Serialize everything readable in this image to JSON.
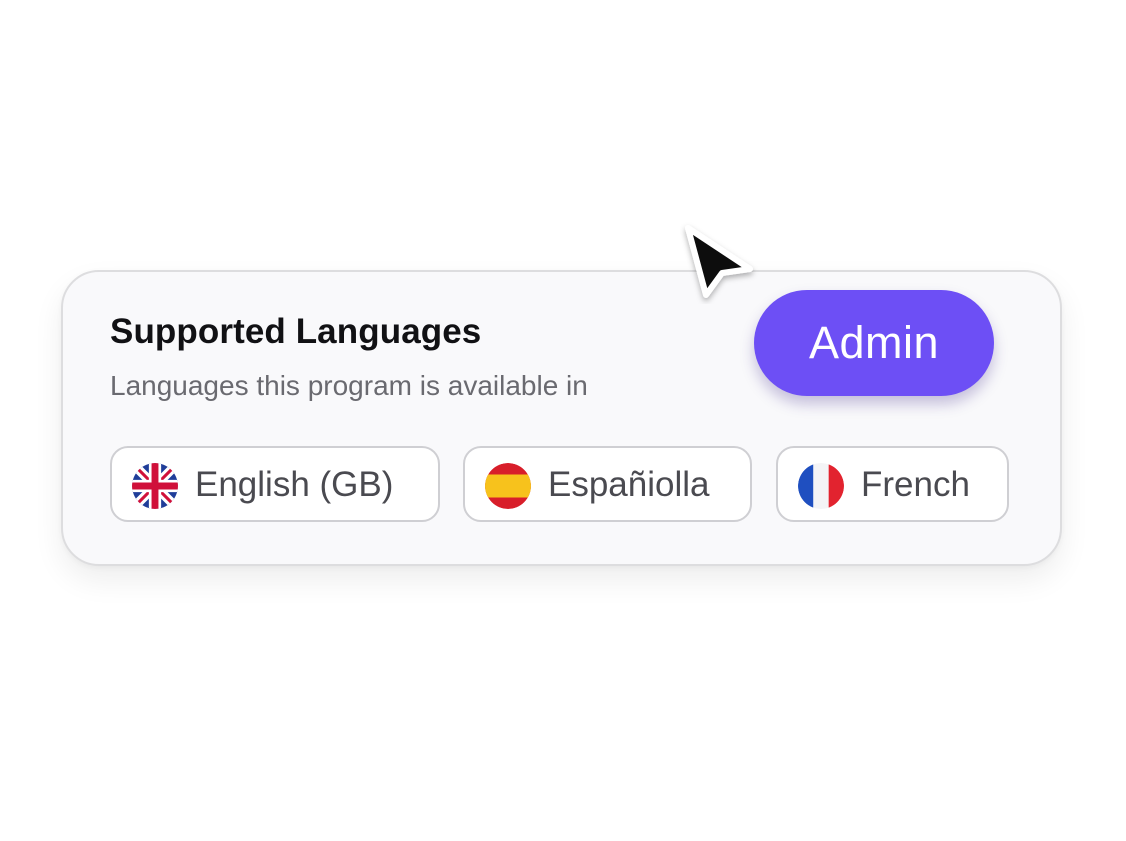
{
  "card": {
    "title": "Supported Languages",
    "subtitle": "Languages this program is available in"
  },
  "admin_button": {
    "label": "Admin",
    "color": "#6d4ff5"
  },
  "languages": [
    {
      "label": "English (GB)",
      "icon": "uk-flag-icon"
    },
    {
      "label": "Españiolla",
      "icon": "spain-flag-icon"
    },
    {
      "label": "French",
      "icon": "france-flag-icon"
    }
  ],
  "cursor": {
    "icon": "mouse-pointer-icon"
  }
}
